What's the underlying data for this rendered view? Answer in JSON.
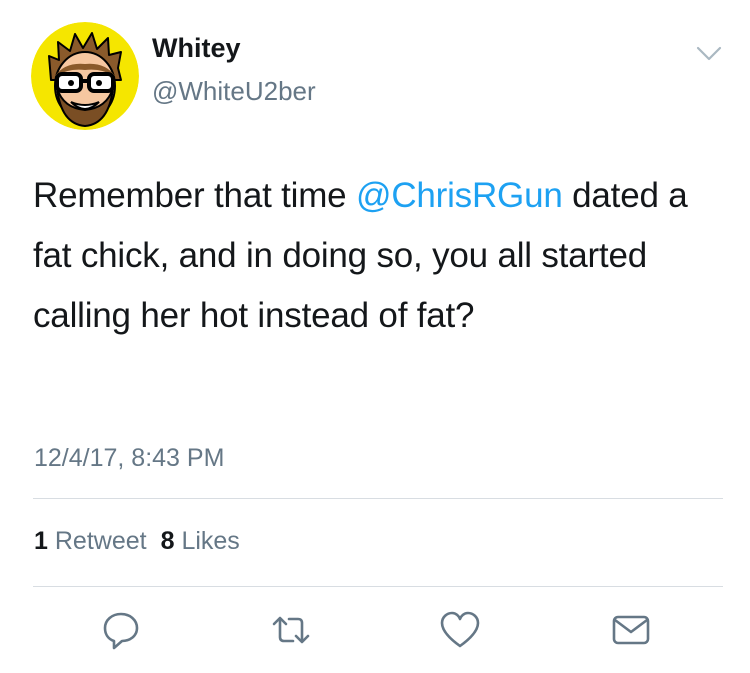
{
  "user": {
    "name": "Whitey",
    "handle": "@WhiteU2ber",
    "avatar_icon": "cartoon-avatar-icon"
  },
  "tweet": {
    "text_before": "Remember that time ",
    "mention": "@ChrisRGun",
    "text_after": " dated a fat chick, and in doing so, you all started calling her hot instead of fat?",
    "timestamp": "12/4/17, 8:43 PM"
  },
  "stats": {
    "retweets_count": "1",
    "retweets_label": "Retweet",
    "likes_count": "8",
    "likes_label": "Likes"
  },
  "actions": [
    "reply-icon",
    "retweet-icon",
    "like-icon",
    "direct-message-icon"
  ],
  "colors": {
    "text": "#14171a",
    "secondary": "#657786",
    "link": "#1da1f2",
    "divider": "#d8dde2",
    "avatar_background": "#f5e600"
  }
}
